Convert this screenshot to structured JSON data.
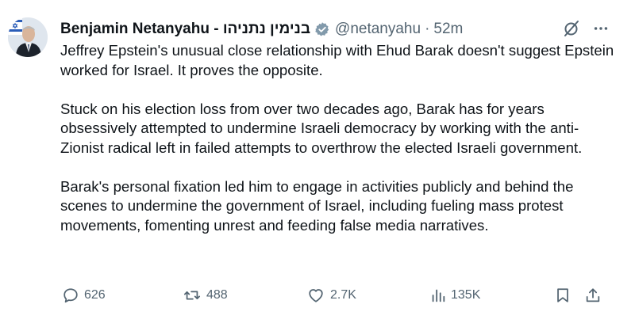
{
  "author": {
    "display_name": "Benjamin Netanyahu - בנימין נתניהו",
    "handle": "@netanyahu",
    "separator": "·",
    "time": "52m",
    "verified_icon": "verified-badge-icon",
    "verified_color": "#829aab"
  },
  "tweet": {
    "paragraphs": [
      "Jeffrey Epstein's unusual close relationship with Ehud Barak doesn't suggest Epstein worked for Israel. It proves the opposite.",
      "Stuck on his election loss from over two decades ago, Barak has for years obsessively attempted to undermine Israeli democracy by working with the anti-Zionist radical left in failed attempts to overthrow the elected Israeli government.",
      "Barak's personal fixation led him to engage in activities publicly and behind the scenes to undermine the government of Israel, including fueling mass protest movements, fomenting unrest and feeding false media narratives."
    ]
  },
  "actions": {
    "reply_count": "626",
    "retweet_count": "488",
    "like_count": "2.7K",
    "views_count": "135K",
    "icons": [
      "reply-icon",
      "retweet-icon",
      "like-icon",
      "views-icon",
      "bookmark-icon",
      "share-icon",
      "grok-icon",
      "more-icon"
    ]
  },
  "colors": {
    "text": "#0f1419",
    "secondary": "#536471"
  }
}
